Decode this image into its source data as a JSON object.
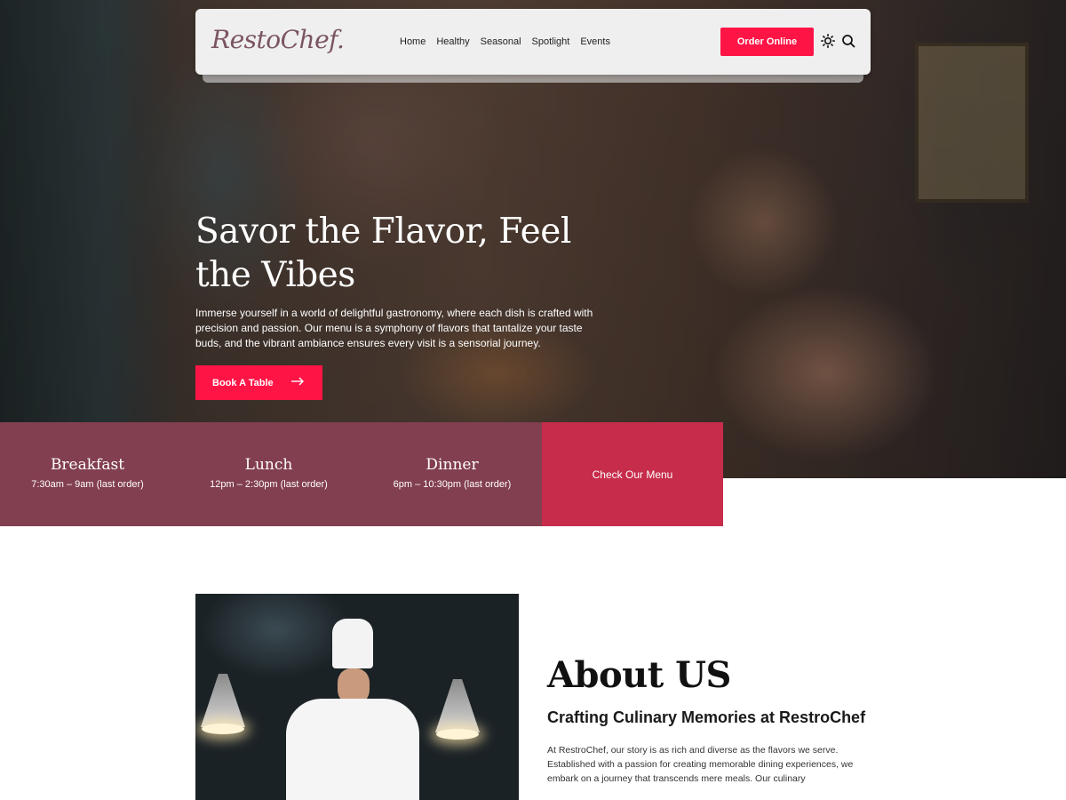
{
  "brand": {
    "logo_text": "RestoChef."
  },
  "nav": {
    "items": [
      {
        "label": "Home"
      },
      {
        "label": "Healthy"
      },
      {
        "label": "Seasonal"
      },
      {
        "label": "Spotlight"
      },
      {
        "label": "Events"
      }
    ],
    "order_button": "Order Online",
    "icons": [
      "sun-icon",
      "search-icon"
    ]
  },
  "hero": {
    "title": "Savor the Flavor, Feel the Vibes",
    "text": "Immerse yourself in a world of delightful gastronomy, where each dish is crafted with precision and passion. Our menu is a symphony of flavors that tantalize your taste buds, and the vibrant ambiance ensures every visit is a sensorial journey.",
    "button_label": "Book A Table",
    "button_icon": "arrow-right-icon"
  },
  "hours": [
    {
      "label": "Breakfast",
      "time": "7:30am – 9am (last order)"
    },
    {
      "label": "Lunch",
      "time": "12pm – 2:30pm (last order)"
    },
    {
      "label": "Dinner",
      "time": "6pm – 10:30pm (last order)"
    }
  ],
  "menu_cta": "Check Our Menu",
  "about": {
    "title": "About US",
    "subtitle": "Crafting Culinary Memories at RestroChef",
    "text": "At RestroChef, our story is as rich and diverse as the flavors we serve. Established with a passion for creating memorable dining experiences, we embark on a journey that transcends mere meals. Our culinary"
  },
  "colors": {
    "accent": "#ff1446",
    "hours_bg": "#823f4f",
    "menu_cta_bg": "#c72c4b",
    "header_bg": "#efefef"
  }
}
